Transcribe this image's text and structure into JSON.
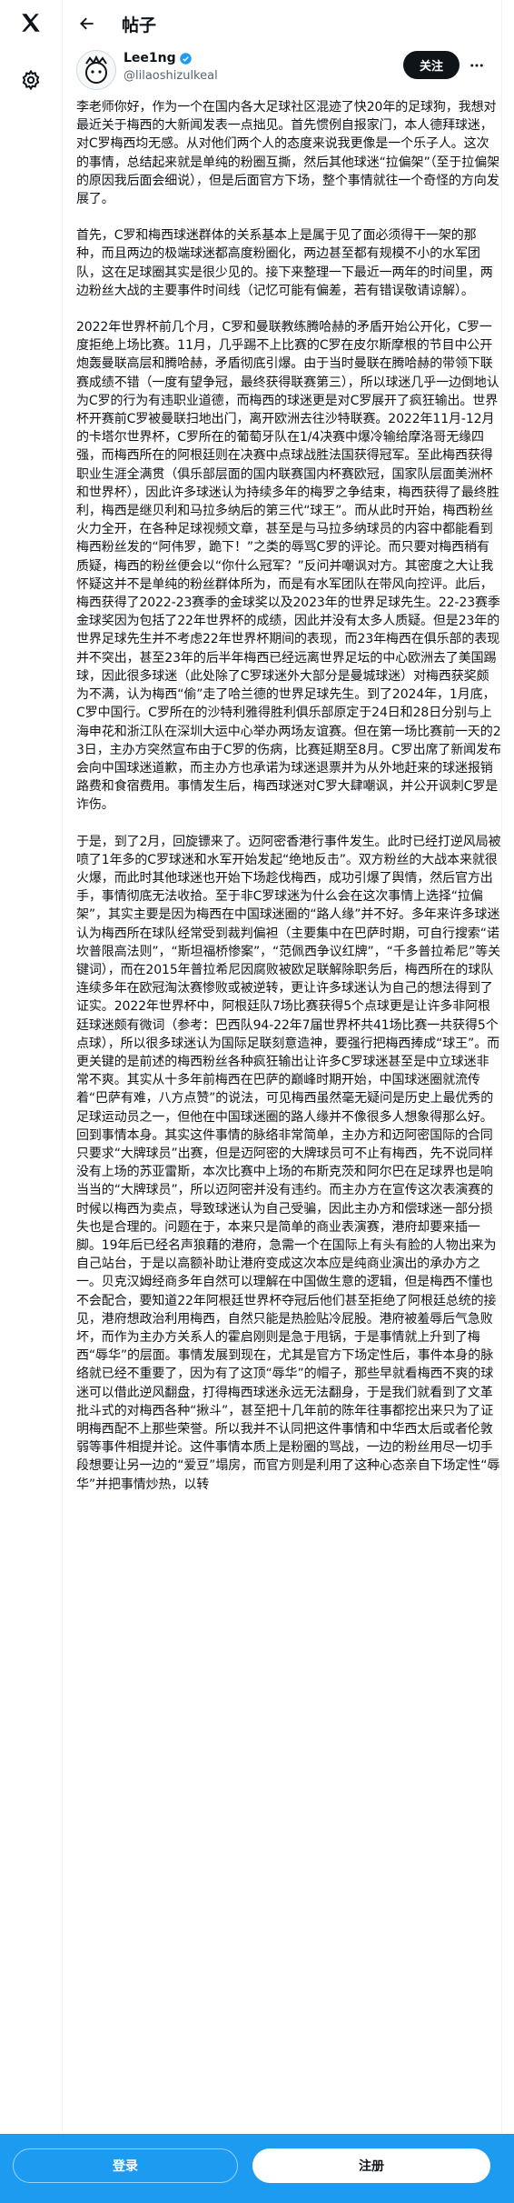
{
  "nav": {
    "logo_icon": "x-logo-icon",
    "settings_icon": "gear-icon"
  },
  "header": {
    "back_icon": "arrow-left-icon",
    "title": "帖子"
  },
  "author": {
    "name": "Lee1ng",
    "handle": "@lilaoshizulkeal",
    "verified": true,
    "follow_label": "关注",
    "more_icon": "more-icon"
  },
  "post": {
    "paragraphs": [
      "李老师你好，作为一个在国内各大足球社区混迹了快20年的足球狗，我想对最近关于梅西的大新闻发表一点拙见。首先惯例自报家门，本人德拜球迷，对C罗梅西均无感。从对他们两个人的态度来说我更像是一个乐子人。这次的事情，总结起来就是单纯的粉圈互撕，然后其他球迷“拉偏架”（至于拉偏架的原因我后面会细说），但是后面官方下场，整个事情就往一个奇怪的方向发展了。",
      "首先，C罗和梅西球迷群体的关系基本上是属于见了面必须得干一架的那种，而且两边的极端球迷都高度粉圈化，两边甚至都有规模不小的水军团队，这在足球圈其实是很少见的。接下来整理一下最近一两年的时间里，两边粉丝大战的主要事件时间线（记忆可能有偏差，若有错误敬请谅解）。",
      "2022年世界杯前几个月，C罗和曼联教练腾哈赫的矛盾开始公开化，C罗一度拒绝上场比赛。11月，几乎踢不上比赛的C罗在皮尔斯摩根的节目中公开炮轰曼联高层和腾哈赫，矛盾彻底引爆。由于当时曼联在腾哈赫的带领下联赛成绩不错（一度有望争冠，最终获得联赛第三），所以球迷几乎一边倒地认为C罗的行为有违职业道德，而梅西的球迷更是对C罗展开了疯狂输出。世界杯开赛前C罗被曼联扫地出门，离开欧洲去往沙特联赛。2022年11月-12月的卡塔尔世界杯，C罗所在的葡萄牙队在1/4决赛中爆冷输给摩洛哥无缘四强，而梅西所在的阿根廷则在决赛中点球战胜法国获得冠军。至此梅西获得职业生涯全满贯（俱乐部层面的国内联赛国内杯赛欧冠，国家队层面美洲杯和世界杯），因此许多球迷认为持续多年的梅罗之争结束，梅西获得了最终胜利，梅西是继贝利和马拉多纳后的第三代“球王”。而从此时开始，梅西粉丝火力全开，在各种足球视频文章，甚至是与马拉多纳球员的内容中都能看到梅西粉丝发的“阿伟罗，跪下！”之类的辱骂C罗的评论。而只要对梅西稍有质疑，梅西的粉丝便会以“你什么冠军？”反问并嘲讽对方。其密度之大让我怀疑这并不是单纯的粉丝群体所为，而是有水军团队在带风向控评。此后，梅西获得了2022-23赛季的金球奖以及2023年的世界足球先生。22-23赛季金球奖因为包括了22年世界杯的成绩，因此并没有太多人质疑。但是23年的世界足球先生并不考虑22年世界杯期间的表现，而23年梅西在俱乐部的表现并不突出，甚至23年的后半年梅西已经远离世界足坛的中心欧洲去了美国踢球，因此很多球迷（此处除了C罗球迷外大部分是曼城球迷）对梅西获奖颇为不满，认为梅西“偷”走了哈兰德的世界足球先生。到了2024年，1月底，C罗中国行。C罗所在的沙特利雅得胜利俱乐部原定于24日和28日分别与上海申花和浙江队在深圳大运中心举办两场友谊赛。但在第一场比赛前一天的23日，主办方突然宣布由于C罗的伤病，比赛延期至8月。C罗出席了新闻发布会向中国球迷道歉，而主办方也承诺为球迷退票并为从外地赶来的球迷报销路费和食宿费用。事情发生后，梅西球迷对C罗大肆嘲讽，并公开讽刺C罗是诈伤。",
      "于是，到了2月，回旋镖来了。迈阿密香港行事件发生。此时已经打逆风局被喷了1年多的C罗球迷和水军开始发起“绝地反击”。双方粉丝的大战本来就很火爆，而此时其他球迷也开始下场趁伐梅西，成功引爆了舆情，然后官方出手，事情彻底无法收拾。至于非C罗球迷为什么会在这次事情上选择“拉偏架”，其实主要是因为梅西在中国球迷圈的“路人缘”并不好。多年来许多球迷认为梅西所在球队经常受到裁判偏袒（主要集中在巴萨时期，可自行搜索“诺坎普限高法则”，“斯坦福桥惨案”，“范佩西争议红牌”，“千多普拉希尼”等关键词），而在2015年普拉希尼因腐败被欧足联解除职务后，梅西所在的球队连续多年在欧冠淘汰赛惨败或被逆转，更让许多球迷认为自己的想法得到了证实。2022年世界杯中，阿根廷队7场比赛获得5个点球更是让许多非阿根廷球迷颇有微词（参考：巴西队94-22年7届世界杯共41场比赛一共获得5个点球），所以很多球迷认为国际足联刻意造神，要强行把梅西捧成“球王”。而更关键的是前述的梅西粉丝各种疯狂输出让许多C罗球迷甚至是中立球迷非常不爽。其实从十多年前梅西在巴萨的巅峰时期开始，中国球迷圈就流传着“巴萨有难，八方点赞”的说法，可见梅西虽然毫无疑问是历史上最优秀的足球运动员之一，但他在中国球迷圈的路人缘并不像很多人想象得那么好。回到事情本身。其实这件事情的脉络非常简单，主办方和迈阿密国际的合同只要求“大牌球员”出赛，但是迈阿密的大牌球员可不止有梅西，先不说同样没有上场的苏亚雷斯，本次比赛中上场的布斯克茨和阿尔巴在足球界也是响当当的“大牌球员”，所以迈阿密并没有违约。而主办方在宣传这次表演赛的时候以梅西为卖点，导致球迷认为自己受骗，因此主办方和偿球迷一部分损失也是合理的。问题在于，本来只是简单的商业表演赛，港府却要来插一脚。19年后已经名声狼藉的港府，急需一个在国际上有头有脸的人物出来为自己站台，于是以高额补助让港府变成这次本应是纯商业演出的承办方之一。贝克汉姆经商多年自然可以理解在中国做生意的逻辑，但是梅西不懂也不会配合，要知道22年阿根廷世界杯夺冠后他们甚至拒绝了阿根廷总统的接见，港府想政治利用梅西，自然只能是热脸贴冷屁股。港府被羞辱后气急败坏，而作为主办方关系人的霍启刚则是急于甩锅，于是事情就上升到了梅西“辱华”的层面。事情发展到现在，尤其是官方下场定性后，事件本身的脉络就已经不重要了，因为有了这顶“辱华”的帽子，那些早就看梅西不爽的球迷可以借此逆风翻盘，打得梅西球迷永远无法翻身，于是我们就看到了文革批斗式的对梅西各种“揪斗”，甚至把十几年前的陈年往事都挖出来只为了证明梅西配不上那些荣誉。所以我并不认同把这件事情和中华西太后或者伦敦弱等事件相提并论。这件事情本质上是粉圈的骂战，一边的粉丝用尽一切手段想要让另一边的“爱豆”塌房，而官方则是利用了这种心态亲自下场定性“辱华”并把事情炒热，以转"
    ]
  },
  "footer": {
    "login_label": "登录",
    "signup_label": "注册"
  }
}
